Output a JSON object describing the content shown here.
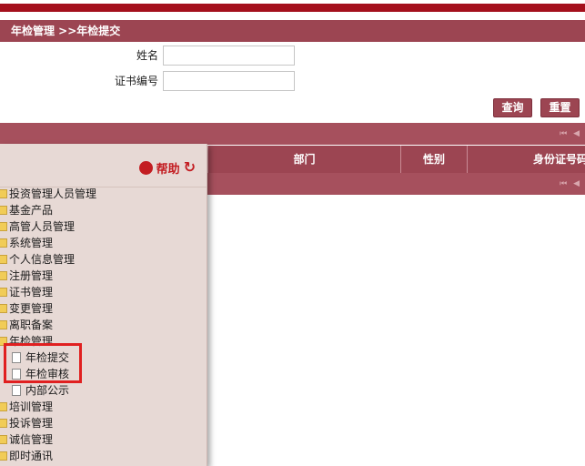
{
  "breadcrumb": "年检管理 >>年检提交",
  "form": {
    "name_label": "姓名",
    "name_value": "",
    "cert_label": "证书编号",
    "cert_value": ""
  },
  "buttons": {
    "query": "查询",
    "reset": "重置"
  },
  "table_headers": [
    "部门",
    "性别",
    "身份证号码"
  ],
  "pager_icons": "⏮ ◀",
  "menu": {
    "help_label": "帮助",
    "refresh_icon": "↻",
    "items": [
      {
        "label": "投资管理人员管理",
        "type": "folder"
      },
      {
        "label": "基金产品",
        "type": "folder"
      },
      {
        "label": "高管人员管理",
        "type": "folder"
      },
      {
        "label": "系统管理",
        "type": "folder"
      },
      {
        "label": "个人信息管理",
        "type": "folder"
      },
      {
        "label": "注册管理",
        "type": "folder"
      },
      {
        "label": "证书管理",
        "type": "folder"
      },
      {
        "label": "变更管理",
        "type": "folder"
      },
      {
        "label": "离职备案",
        "type": "folder"
      },
      {
        "label": "年检管理",
        "type": "folder"
      },
      {
        "label": "年检提交",
        "type": "leaf"
      },
      {
        "label": "年检审核",
        "type": "leaf"
      },
      {
        "label": "内部公示",
        "type": "leaf"
      },
      {
        "label": "培训管理",
        "type": "folder"
      },
      {
        "label": "投诉管理",
        "type": "folder"
      },
      {
        "label": "诚信管理",
        "type": "folder"
      },
      {
        "label": "即时通讯",
        "type": "folder"
      }
    ]
  },
  "colors": {
    "accent": "#9c4552",
    "brand_red": "#a4101c",
    "help_red": "#c31d22",
    "highlight": "#e02020"
  }
}
